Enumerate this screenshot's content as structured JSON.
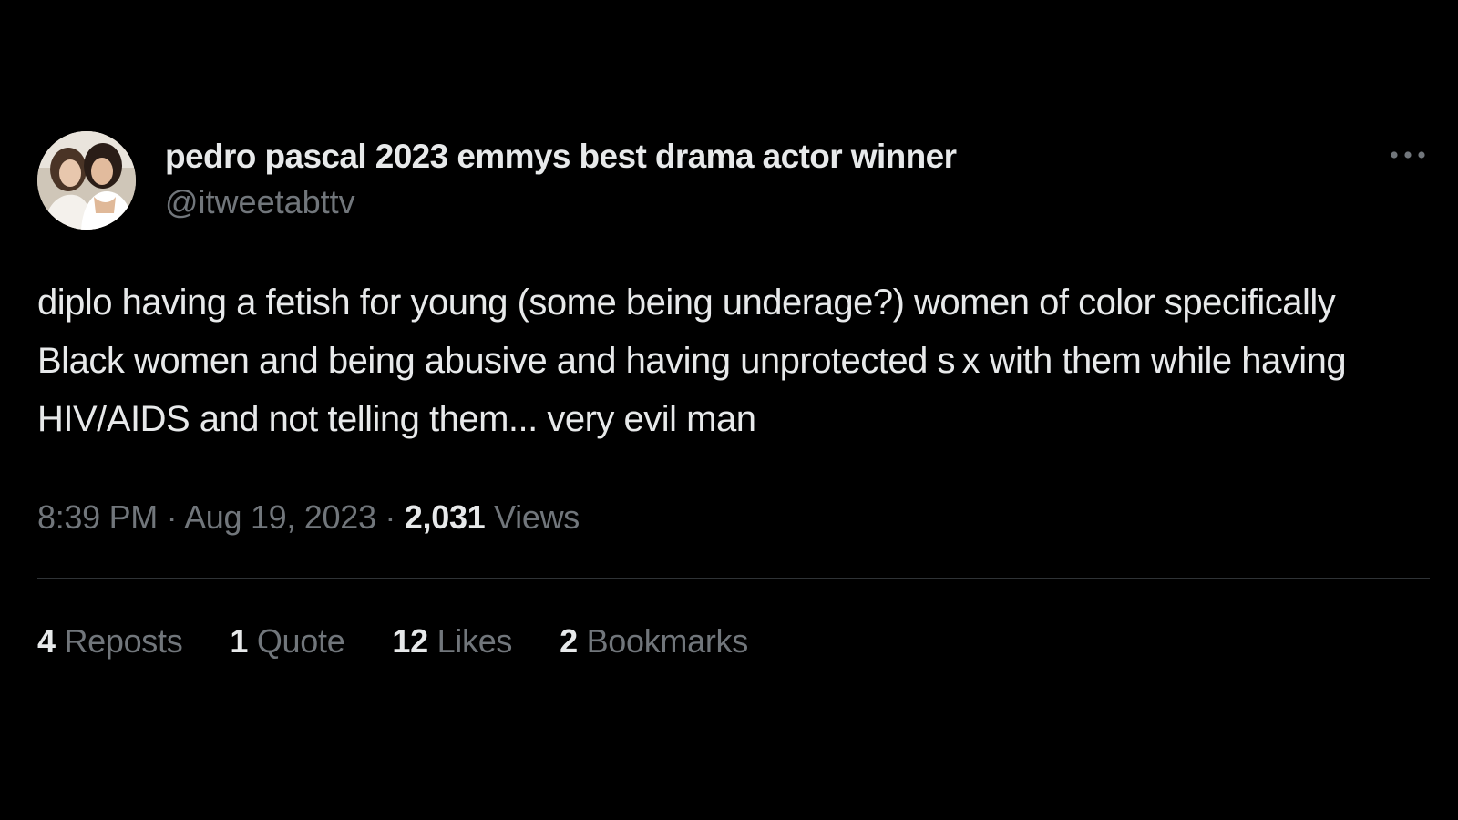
{
  "author": {
    "display_name": "pedro pascal 2023 emmys best drama actor winner",
    "handle": "@itweetabttv",
    "avatar": "profile-photo"
  },
  "more_icon": "ellipsis-icon",
  "tweet": {
    "text": "diplo having a fetish for young (some being underage?) women of color specifically Black women and being abusive and having unprotected s x with them while having HIV/AIDS and not telling them... very evil man"
  },
  "meta": {
    "time": "8:39 PM",
    "separator": "·",
    "date": "Aug 19, 2023",
    "views_count": "2,031",
    "views_label": "Views"
  },
  "stats": {
    "reposts": {
      "count": "4",
      "label": "Reposts"
    },
    "quotes": {
      "count": "1",
      "label": "Quote"
    },
    "likes": {
      "count": "12",
      "label": "Likes"
    },
    "bookmarks": {
      "count": "2",
      "label": "Bookmarks"
    }
  },
  "colors": {
    "background": "#000000",
    "primary_text": "#e7e9ea",
    "secondary_text": "#71767b",
    "divider": "#2f3336"
  }
}
